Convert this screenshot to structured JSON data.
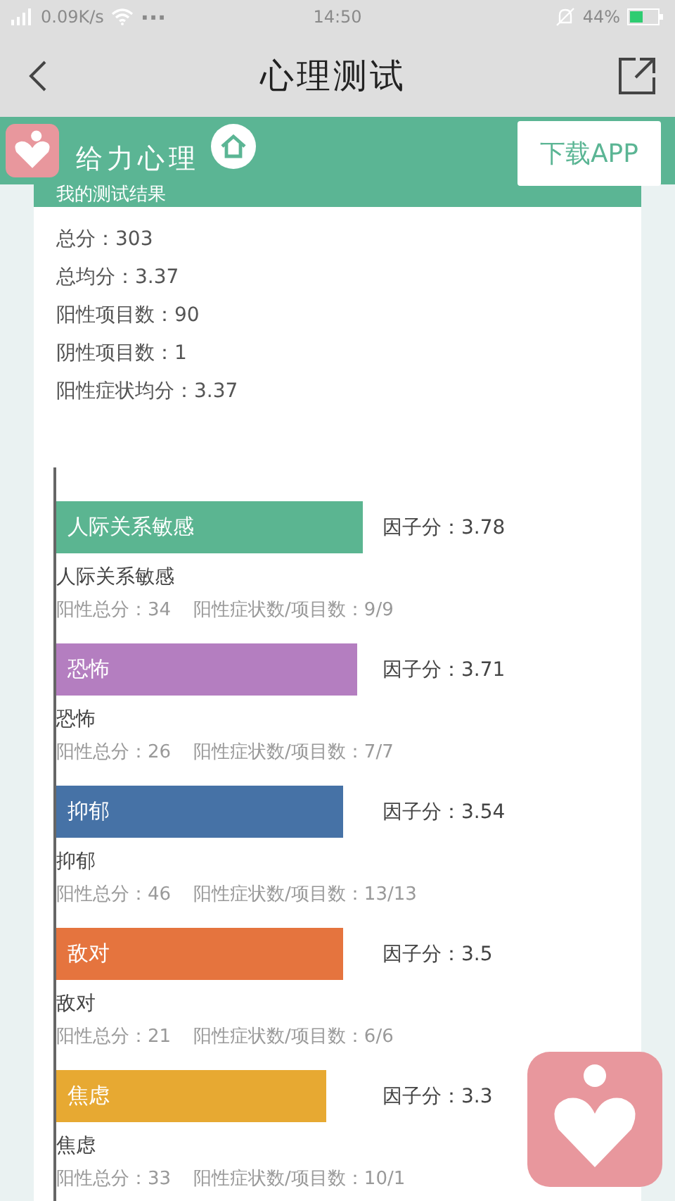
{
  "status_bar": {
    "speed": "0.09K/s",
    "dots": "···",
    "time": "14:50",
    "battery": "44%"
  },
  "nav": {
    "title": "心理测试"
  },
  "banner": {
    "brand": "给力心理",
    "download": "下载APP"
  },
  "card": {
    "title": "我的测试结果",
    "summary": [
      "总分：303",
      "总均分：3.37",
      "阳性项目数：90",
      "阴性项目数：1",
      "阳性症状均分：3.37"
    ],
    "factors": [
      {
        "name": "人际关系敏感",
        "color": "#5bb591",
        "score": "因子分：3.78",
        "label": "人际关系敏感",
        "total": "阳性总分：34",
        "ratio": "阳性症状数/项目数：9/9"
      },
      {
        "name": "恐怖",
        "color": "#b47ec0",
        "score": "因子分：3.71",
        "label": "恐怖",
        "total": "阳性总分：26",
        "ratio": "阳性症状数/项目数：7/7"
      },
      {
        "name": "抑郁",
        "color": "#4672a6",
        "score": "因子分：3.54",
        "label": "抑郁",
        "total": "阳性总分：46",
        "ratio": "阳性症状数/项目数：13/13"
      },
      {
        "name": "敌对",
        "color": "#e5743e",
        "score": "因子分：3.5",
        "label": "敌对",
        "total": "阳性总分：21",
        "ratio": "阳性症状数/项目数：6/6"
      },
      {
        "name": "焦虑",
        "color": "#e7a932",
        "score": "因子分：3.3",
        "label": "焦虑",
        "total": "阳性总分：33",
        "ratio": "阳性症状数/项目数：10/1"
      }
    ]
  }
}
